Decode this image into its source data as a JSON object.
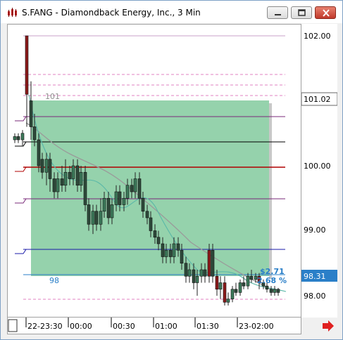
{
  "window": {
    "title": "S.FANG - Diamondback Energy, Inc., 3 Min"
  },
  "price_axis": {
    "ticks": [
      "102.00",
      "100.00",
      "99.00",
      "98.00"
    ],
    "current_price_label": "101.02",
    "last_price_label": "98.31"
  },
  "time_axis": {
    "labels": [
      "22-23:30",
      "00:00",
      "00:30",
      "01:00",
      "01:30",
      "23-02:00"
    ]
  },
  "annotations": {
    "level_101": "101",
    "level_98": "98",
    "box_change_value": "$2.71",
    "box_change_pct": "2.68 %"
  },
  "colors": {
    "box_fill": "#8fd0a8",
    "candle_body": "#2e4a3a",
    "red_line": "#b00000",
    "blue_line": "#1a1aa8",
    "purple_line": "#7a2a7a",
    "pink_dashed": "#e080c0",
    "last_price_bg": "#2a7fc8",
    "arrow_red": "#e02020"
  },
  "icons": {
    "app": "stock-chart-icon",
    "minimize": "minimize-icon",
    "maximize": "maximize-icon",
    "close": "close-icon",
    "scroll": "right-arrow-icon"
  }
}
